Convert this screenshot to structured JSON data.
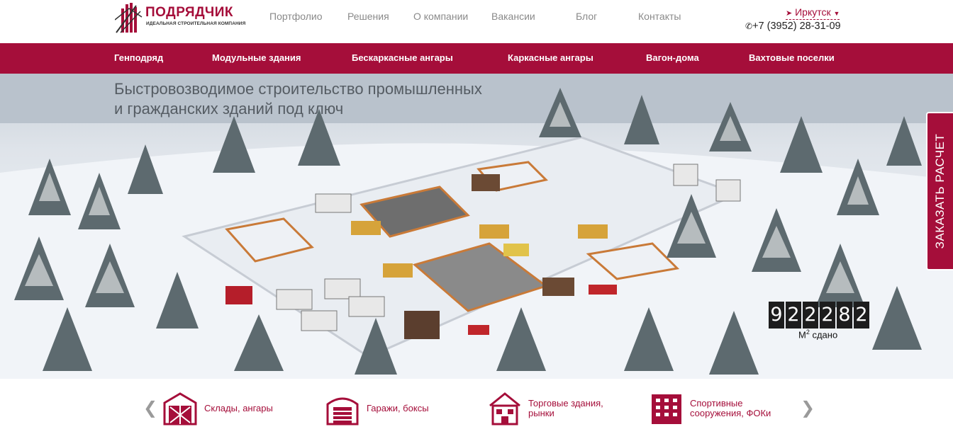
{
  "brand": {
    "name": "ПОДРЯДЧИК",
    "tagline": "ИДЕАЛЬНАЯ СТРОИТЕЛЬНАЯ КОМПАНИЯ",
    "accent": "#a50e3a"
  },
  "topnav": [
    "Портфолио",
    "Решения",
    "О компании",
    "Вакансии",
    "Блог",
    "Контакты"
  ],
  "city": "Иркутск",
  "phone": "+7 (3952) 28-31-09",
  "catnav": [
    "Генподряд",
    "Модульные здания",
    "Бескаркасные ангары",
    "Каркасные ангары",
    "Вагон-дома",
    "Вахтовые поселки"
  ],
  "hero": {
    "title_line1": "Быстровозводимое строительство промышленных",
    "title_line2": "и гражданских зданий под ключ",
    "cta": "ЗАКАЗАТЬ РАСЧЕТ",
    "counter": [
      "9",
      "2",
      "2",
      "2",
      "8",
      "2"
    ],
    "counter_unit": "М",
    "counter_sup": "2",
    "counter_label": " сдано"
  },
  "categories": [
    {
      "label": "Склады, ангары",
      "icon": "warehouse-icon"
    },
    {
      "label": "Гаражи, боксы",
      "icon": "garage-icon"
    },
    {
      "label": "Торговые здания,\nрынки",
      "icon": "house-icon"
    },
    {
      "label": "Спортивные\nсооружения, ФОКи",
      "icon": "building-icon"
    }
  ]
}
